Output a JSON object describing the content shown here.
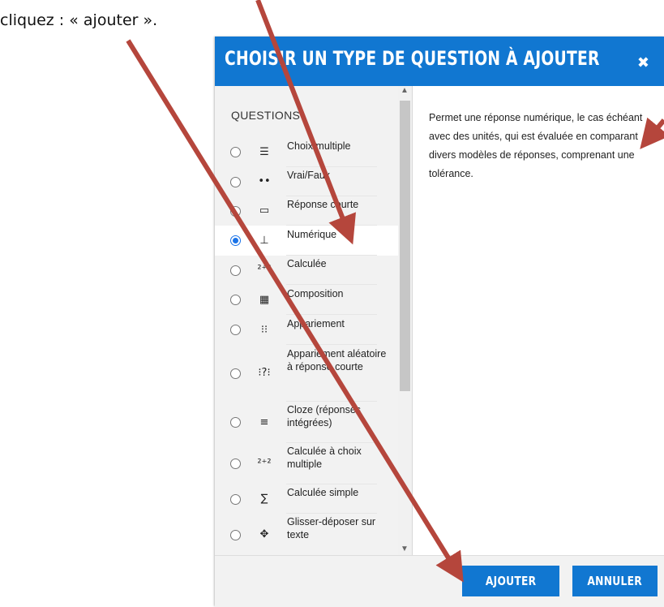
{
  "instruction": "cliquez : « ajouter ».",
  "dialog": {
    "title": "CHOISIR UN TYPE DE QUESTION À AJOUTER",
    "close_icon": "✖",
    "section_title": "QUESTIONS",
    "questions": [
      {
        "label": "Choix multiple",
        "icon": "☰",
        "selected": false
      },
      {
        "label": "Vrai/Faux",
        "icon": "••",
        "selected": false
      },
      {
        "label": "Réponse courte",
        "icon": "▭",
        "selected": false
      },
      {
        "label": "Numérique",
        "icon": "⊥",
        "selected": true
      },
      {
        "label": "Calculée",
        "icon": "²⁺²",
        "selected": false
      },
      {
        "label": "Composition",
        "icon": "▦",
        "selected": false
      },
      {
        "label": "Appariement",
        "icon": "⁝⁝",
        "selected": false
      },
      {
        "label": "Appariement aléatoire à réponse courte",
        "icon": "⁝?⁝",
        "selected": false
      },
      {
        "label": "Cloze (réponses intégrées)",
        "icon": "≡",
        "selected": false
      },
      {
        "label": "Calculée à choix multiple",
        "icon": "²⁺²",
        "selected": false
      },
      {
        "label": "Calculée simple",
        "icon": "∑",
        "selected": false
      },
      {
        "label": "Glisser-déposer sur texte",
        "icon": "✥",
        "selected": false
      }
    ],
    "description": "Permet une réponse numérique, le cas échéant avec des unités, qui est évaluée en comparant divers modèles de réponses, comprenant une tolérance.",
    "buttons": {
      "add": "AJOUTER",
      "cancel": "ANNULER"
    }
  },
  "colors": {
    "header": "#1177d1",
    "arrow": "#b5463c"
  }
}
